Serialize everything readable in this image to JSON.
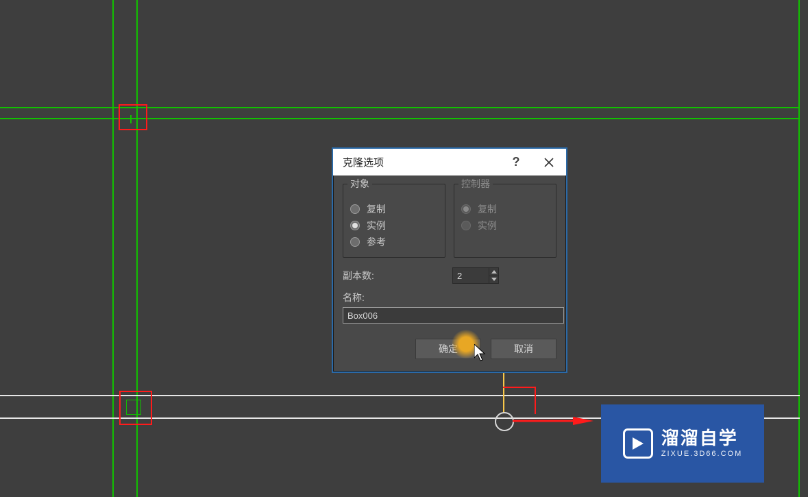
{
  "dialog": {
    "title": "克隆选项",
    "object_group": {
      "label": "对象",
      "copy": "复制",
      "instance": "实例",
      "reference": "参考"
    },
    "controller_group": {
      "label": "控制器",
      "copy": "复制",
      "instance": "实例"
    },
    "copies_label": "副本数:",
    "copies_value": "2",
    "name_label": "名称:",
    "name_value": "Box006",
    "ok": "确定",
    "cancel": "取消"
  },
  "logo": {
    "main": "溜溜自学",
    "sub": "ZIXUE.3D66.COM"
  }
}
